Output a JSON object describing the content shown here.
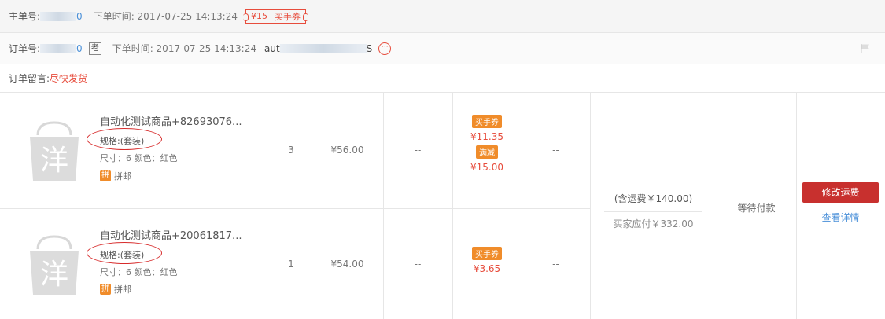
{
  "main_order": {
    "label": "主单号: ",
    "id_end": "0",
    "time_label": "下单时间: 2017-07-25 14:13:24",
    "coupon_amount": "¥15",
    "coupon_text": "买手券"
  },
  "sub_order": {
    "label": "订单号: ",
    "id_end": "0",
    "old_badge": "老",
    "time_label": "下单时间: 2017-07-25 14:13:24",
    "account_start": "aut",
    "account_end": "S"
  },
  "note": {
    "label": "订单留言: ",
    "text": "尽快发货"
  },
  "items": [
    {
      "title": "自动化测试商品+82693076...",
      "spec": "规格:(套装)",
      "size": "尺寸：6 颜色：红色",
      "spell_icon": "拼",
      "spell_text": "拼邮",
      "qty": "3",
      "price": "¥56.00",
      "col_a": "--",
      "discounts": [
        {
          "badge": "买手券",
          "value": "¥11.35"
        },
        {
          "badge": "满减",
          "value": "¥15.00"
        }
      ],
      "col_b": "--"
    },
    {
      "title": "自动化测试商品+20061817...",
      "spec": "规格:(套装)",
      "size": "尺寸：6 颜色：红色",
      "spell_icon": "拼",
      "spell_text": "拼邮",
      "qty": "1",
      "price": "¥54.00",
      "col_a": "--",
      "discounts": [
        {
          "badge": "买手券",
          "value": "¥3.65"
        }
      ],
      "col_b": "--"
    }
  ],
  "summary": {
    "dash": "--",
    "shipping": "(含运费￥140.00)",
    "payable": "买家应付￥332.00"
  },
  "status": "等待付款",
  "actions": {
    "modify_shipping": "修改运费",
    "view_details": "查看详情"
  },
  "colors": {
    "accent_red": "#c8302e",
    "discount_orange": "#f08c2a",
    "link_blue": "#4a90d9"
  }
}
